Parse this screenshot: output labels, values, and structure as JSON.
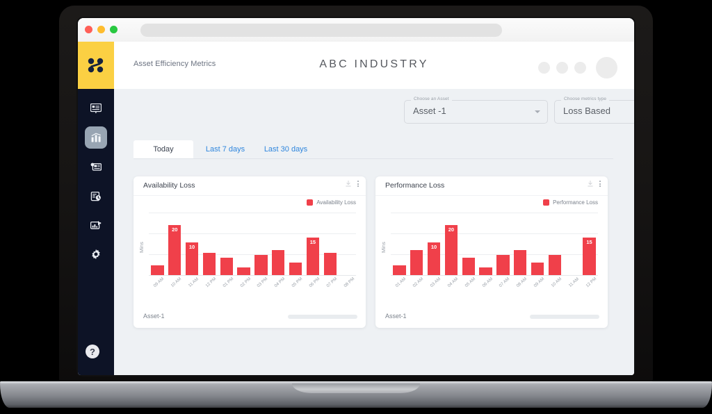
{
  "browser": {
    "traffic_lights": [
      "close",
      "minimize",
      "maximize"
    ],
    "url_value": ""
  },
  "sidebar": {
    "logo": "logo-icon",
    "items": [
      {
        "icon": "presentation-board-icon",
        "label": "Dashboard",
        "active": false
      },
      {
        "icon": "bar-chart-icon",
        "label": "Metrics",
        "active": true
      },
      {
        "icon": "report-image-icon",
        "label": "Reports",
        "active": false
      },
      {
        "icon": "clipboard-clock-icon",
        "label": "Schedule",
        "active": false
      },
      {
        "icon": "chart-up-icon",
        "label": "Analytics",
        "active": false
      },
      {
        "icon": "gear-icon",
        "label": "Settings",
        "active": false
      }
    ],
    "help_label": "?"
  },
  "header": {
    "subtitle": "Asset Efficiency Metrics",
    "company": "ABC INDUSTRY",
    "icons": [
      "circle-icon",
      "circle-icon",
      "circle-icon"
    ],
    "avatar": "avatar-icon"
  },
  "filters": {
    "asset": {
      "label": "Choose an Asset",
      "value": "Asset -1"
    },
    "metrics": {
      "label": "Choose metrics type",
      "value": "Loss Based"
    }
  },
  "tabs": [
    {
      "label": "Today",
      "active": true
    },
    {
      "label": "Last 7 days",
      "active": false
    },
    {
      "label": "Last 30 days",
      "active": false
    }
  ],
  "colors": {
    "bar": "#f0404a",
    "accent_yellow": "#fbd043",
    "sidebar": "#0d1326",
    "tab_link": "#2f86dd",
    "fab": "#3a35d6"
  },
  "cards": [
    {
      "title": "Availability Loss",
      "legend": "Availability Loss",
      "footer": "Asset-1",
      "download_icon": "download-icon",
      "menu_icon": "more-vertical-icon"
    },
    {
      "title": "Performance Loss",
      "legend": "Performance Loss",
      "footer": "Asset-1",
      "download_icon": "download-icon",
      "menu_icon": "more-vertical-icon"
    }
  ],
  "chart_data": [
    {
      "type": "bar",
      "title": "Availability Loss",
      "xlabel": "",
      "ylabel": "Mins",
      "categories": [
        "09 AM",
        "10 AM",
        "11 AM",
        "12 PM",
        "01 PM",
        "02 PM",
        "03 PM",
        "04 PM",
        "05 PM",
        "06 PM",
        "07 PM",
        "08 PM"
      ],
      "values": [
        4,
        20,
        13,
        9,
        7,
        3,
        8,
        10,
        5,
        15,
        9,
        0
      ],
      "labels": [
        null,
        "20",
        "10",
        null,
        null,
        null,
        null,
        null,
        null,
        "15",
        null,
        null
      ],
      "ylim": [
        0,
        25
      ],
      "grid": true,
      "legend": [
        "Availability Loss"
      ],
      "legend_position": "top-right",
      "series_color": "#f0404a"
    },
    {
      "type": "bar",
      "title": "Performance Loss",
      "xlabel": "",
      "ylabel": "Mins",
      "categories": [
        "01 AM",
        "02 AM",
        "03 AM",
        "04 AM",
        "05 AM",
        "06 AM",
        "07 AM",
        "08 AM",
        "09 AM",
        "10 AM",
        "11 AM",
        "12 PM"
      ],
      "values": [
        4,
        10,
        13,
        20,
        7,
        3,
        8,
        10,
        5,
        8,
        0,
        15
      ],
      "labels": [
        null,
        null,
        "10",
        "20",
        null,
        null,
        null,
        null,
        null,
        null,
        null,
        "15"
      ],
      "ylim": [
        0,
        25
      ],
      "grid": true,
      "legend": [
        "Performance Loss"
      ],
      "legend_position": "top-right",
      "series_color": "#f0404a"
    }
  ],
  "fab": {
    "label": "chat-fab"
  }
}
